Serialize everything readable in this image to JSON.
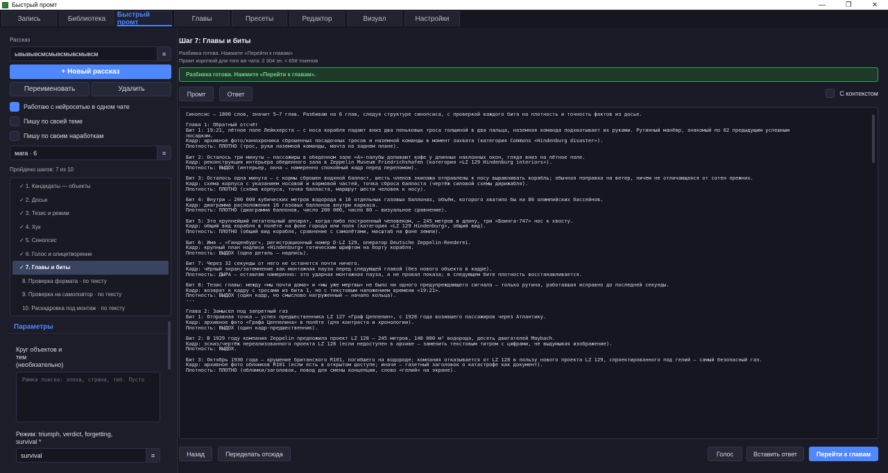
{
  "window": {
    "title": "Быстрый промт",
    "controls": [
      "—",
      "❐",
      "✕"
    ]
  },
  "tabs": [
    {
      "label": "Запись"
    },
    {
      "label": "Библиотека"
    },
    {
      "label": "Быстрый промт",
      "active": true
    },
    {
      "label": "Главы"
    },
    {
      "label": "Пресеты"
    },
    {
      "label": "Редактор"
    },
    {
      "label": "Визуал"
    },
    {
      "label": "Настройки"
    }
  ],
  "sidebar": {
    "story_label": "Рассказ",
    "story_value": "ывывывсмсмывсмывсмывсм",
    "combo_arrow": "≡",
    "new_story": "+ Новый рассказ",
    "rename": "Переименовать",
    "delete": "Удалить",
    "checks": [
      {
        "label": "Работаю с нейросетью в одном чате",
        "checked": true
      },
      {
        "label": "Пишу по своей теме",
        "checked": false
      },
      {
        "label": "Пишу по своим наработкам",
        "checked": false
      }
    ],
    "mode_value": "мага · 6",
    "progress": "Пройдено шагов: 7 из 10",
    "steps": [
      {
        "label": "✓ 1. Кандидаты — объекты",
        "state": "done"
      },
      {
        "label": "✓ 2. Досье",
        "state": "done"
      },
      {
        "label": "✓ 3. Тезис и режим",
        "state": "done"
      },
      {
        "label": "✓ 4. Хук",
        "state": "done"
      },
      {
        "label": "✓ 5. Синопсис",
        "state": "done"
      },
      {
        "label": "✓ 6. Голос и олицетворение",
        "state": "done"
      },
      {
        "label": "✓ 7. Главы и биты",
        "state": "active"
      },
      {
        "label": "8. Проверка формата · по тексту",
        "state": "pending"
      },
      {
        "label": "9. Проверка на самоповтор · по тексту",
        "state": "pending"
      },
      {
        "label": "10. Раскадровка под монтаж · по тексту",
        "state": "pending"
      }
    ],
    "params_title": "Параметры",
    "objects_label_1": "Круг объектов и",
    "objects_label_2": "тем",
    "objects_label_3": "(необязательно)",
    "objects_placeholder": "Рамка поиска: эпоха, страна, тип. Пусто",
    "regime_label_1": "Режим: triumph, verdict, forgetting,",
    "regime_label_2": "survival *",
    "regime_value": "survival"
  },
  "main": {
    "step_title": "Шаг 7: Главы и биты",
    "info_1": "Разбивка готова. Нажмите «Перейти к главам»",
    "info_2": "Промт короткий  для того же чата: 2 304 зн. ≈ 658 токенов",
    "banner": "Разбивка готова. Нажмите «Перейти к главам».",
    "prompt_btn": "Промт",
    "answer_btn": "Ответ",
    "context_label": "С контекстом",
    "output_lines": [
      "Синопсис — 1800 слов, значит 5–7 глав. Разбиваю на 6 глав, следуя структуре синопсиса, с проверкой каждого бита на плотность и точность фактов из досье.",
      "",
      "Глава 1: Обратный отсчёт",
      "Бит 1: 19:21, лётное поле Лейкхерста — с носа корабля падают вниз два пеньковых троса толщиной в два пальца, наземная команда подхватывает их руками. Рутинный манёвр, знакомый по 62 предыдущим успешным",
      "посадкам.",
      "Кадр: архивное фото/кинохроника сброшенных посадочных тросов и наземной команды в момент захвата (категория Commons «Hindenburg disaster»).",
      "Плотность: ПЛОТНО (трос, руки наземной команды, мачта на заднем плане).",
      "",
      "Бит 2: Осталось три минуты — пассажиры в обеденном зале «А»-палубы допивают кофе у длинных наклонных окон, глядя вниз на лётное поле.",
      "Кадр: реконструкция интерьера обеденного зала в Zeppelin Museum Friedrichshafen (категория «LZ 129 Hindenburg interiors»).",
      "Плотность: ВЫДОХ (интерьер, окна — намеренно спокойный кадр перед переломом).",
      "",
      "Бит 3: Осталось одна минута — с кормы сброшен водяной балласт, шесть членов экипажа отправлены к носу выравнивать корабль; обычная поправка на ветер, ничем не отличающаяся от сотен прежних.",
      "Кадр: схема корпуса с указанием носовой и кормовой частей, точка сброса балласта (чертёж силовой схемы дирижабля).",
      "Плотность: ПЛОТНО (схема корпуса, точка балласта, маршрут шести человек к носу).",
      "",
      "Бит 4: Внутри — 200 000 кубических метров водорода в 16 отдельных газовых баллонах, объём, которого хватило бы на 80 олимпийских бассейнов.",
      "Кадр: диаграмма расположения 16 газовых баллонов внутри каркаса.",
      "Плотность: ПЛОТНО (диаграмма баллонов, число 200 000, число 80 — визуальное сравнение).",
      "",
      "Бит 5: Это крупнейший летательный аппарат, когда-либо построенный человеком, — 245 метров в длину, три «Боинга-747» нос к хвосту.",
      "Кадр: общий вид корабля в полёте на фоне города или поля (категория «LZ 129 Hindenburg», общий вид).",
      "Плотность: ПЛОТНО (общий вид корабля, сравнение с самолётами, масштаб на фоне земли).",
      "",
      "Бит 6: Имя — «Гинденбург», регистрационный номер D-LZ 129, оператор Deutsche Zeppelin-Reederei.",
      "Кадр: крупный план надписи «Hindenburg» готическим шрифтом на борту корабля.",
      "Плотность: ВЫДОХ (одна деталь — надпись).",
      "",
      "Бит 7: Через 32 секунды от него не останется почти ничего.",
      "Кадр: чёрный экран/затемнение как монтажная пауза перед следующей главой (без нового объекта в кадре).",
      "Плотность: ДЫРА — оставляю намеренно: это ударная монтажная пауза, а не провал показа; в следующем бите плотность восстанавливается.",
      "",
      "Бит 8: Тезис главы: между «мы почти дома» и «мы уже мертвы» не было ни одного предупреждающего сигнала — только рутина, работавшая исправно до последней секунды.",
      "Кадр: возврат к кадру с тросами из бита 1, но с текстовым наложением времени «19:21».",
      "Плотность: ВЫДОХ (один кадр, но смыслово нагруженный — начало кольца).",
      "---",
      "",
      "Глава 2: Замысел под запретный газ",
      "Бит 1: Отправная точка — успех предшественника LZ 127 «Граф Цеппелин», с 1928 года возившего пассажиров через Атлантику.",
      "Кадр: архивное фото «Графа Цеппелина» в полёте (для контраста и хронологии).",
      "Плотность: ВЫДОХ (один кадр-предшественник).",
      "",
      "Бит 2: В 1929 году компания Zeppelin предложила проект LZ 128 — 245 метров, 140 000 м³ водорода, десять двигателей Maybach.",
      "Кадр: эскиз/чертёж нереализованного проекта LZ 128 (если недоступен в архиве — заменить текстовым титром с цифрами, не выдумывая изображение).",
      "Плотность: ВЫДОХ.",
      "",
      "Бит 3: Октябрь 1930 года — крушение британского R101, погибшего на водороде; компания отказывается от LZ 128 в пользу нового проекта LZ 129, спроектированного под гелий — самый безопасный газ.",
      "Кадр: архивное фото обломков R101 (если есть в открытом доступе; иначе — газетный заголовок о катастрофе как документ).",
      "Плотность: ПЛОТНО (обломки/заголовок, повод для смены концепции, слово «гелий» на экране)."
    ],
    "back_btn": "Назад",
    "redo_btn": "Переделать отсюда",
    "voice_btn": "Голос",
    "insert_btn": "Вставить ответ",
    "go_btn": "Перейти к главам"
  }
}
